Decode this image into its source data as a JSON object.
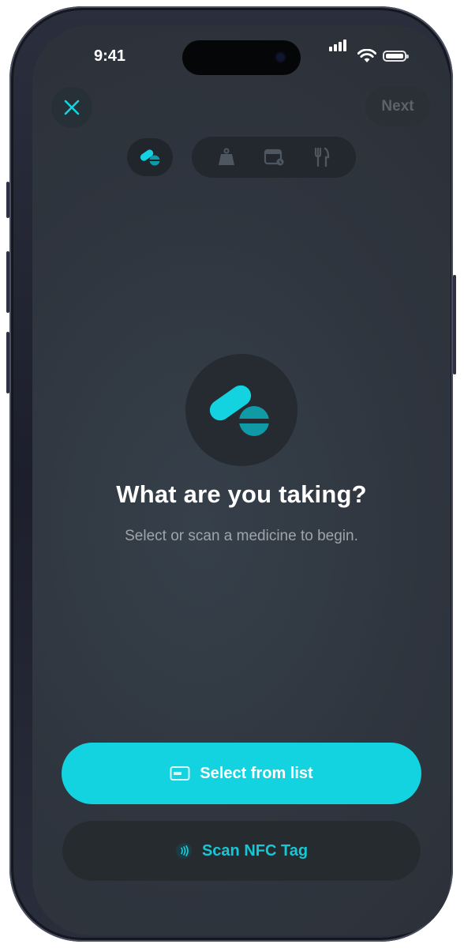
{
  "status_bar": {
    "time": "9:41"
  },
  "header": {
    "close_icon": "close-icon",
    "next_label": "Next"
  },
  "steps": [
    {
      "icon": "pill-icon",
      "active": true
    },
    {
      "icon": "scale-icon",
      "active": false
    },
    {
      "icon": "calendar-icon",
      "active": false
    },
    {
      "icon": "fork-knife-icon",
      "active": false
    }
  ],
  "hero": {
    "icon": "pill-icon",
    "title": "What are you taking?",
    "subtitle": "Select or scan a medicine to begin."
  },
  "actions": {
    "select_label": "Select from list",
    "select_icon": "card-icon",
    "scan_label": "Scan NFC Tag",
    "scan_icon": "nfc-icon"
  },
  "colors": {
    "accent": "#12d3df",
    "accent_dark": "#0f9aa6",
    "background": "#2f353e"
  }
}
